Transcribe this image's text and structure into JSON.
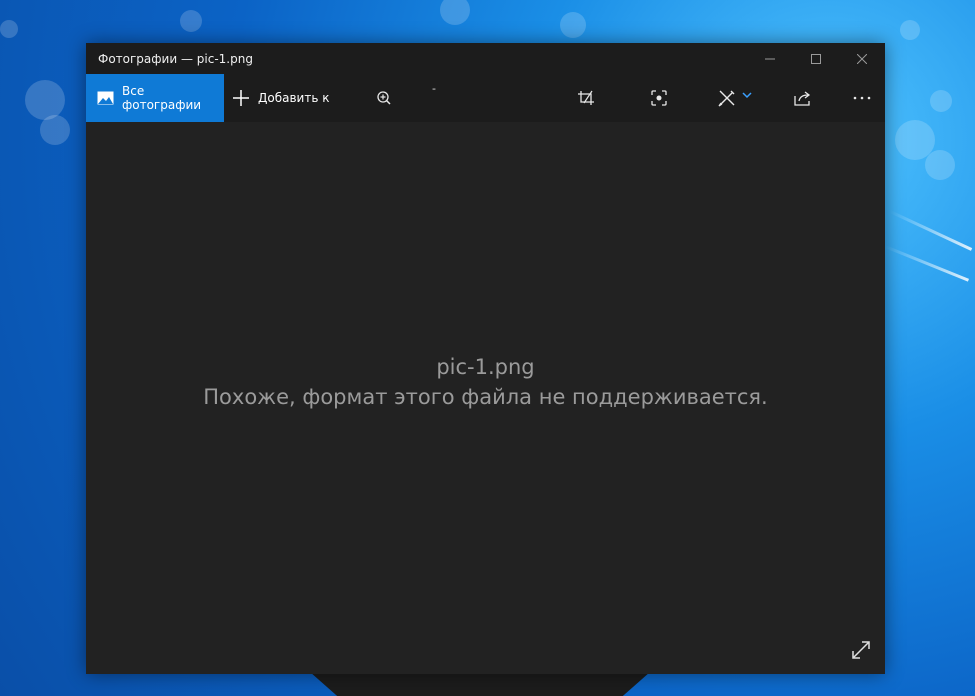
{
  "window": {
    "title": "Фотографии — pic-1.png"
  },
  "toolbar": {
    "all_photos_label": "Все фотографии",
    "add_to_label": "Добавить к",
    "minus_label": "-"
  },
  "viewer": {
    "file_name": "pic-1.png",
    "message": "Похоже, формат этого файла не поддерживается."
  },
  "colors": {
    "accent": "#0f7ad6",
    "window_bg": "#222222",
    "titlebar_bg": "#1c1c1c",
    "message_text": "#9b9b9b"
  },
  "icons": {
    "titlebar": [
      "minimize-icon",
      "maximize-icon",
      "close-icon"
    ],
    "toolbar": [
      "image-icon",
      "plus-icon",
      "zoom-in-icon",
      "crop-icon",
      "focus-icon",
      "edit-draw-icon",
      "chevron-down-icon",
      "share-icon",
      "more-icon"
    ],
    "viewer": [
      "fullscreen-icon"
    ]
  }
}
